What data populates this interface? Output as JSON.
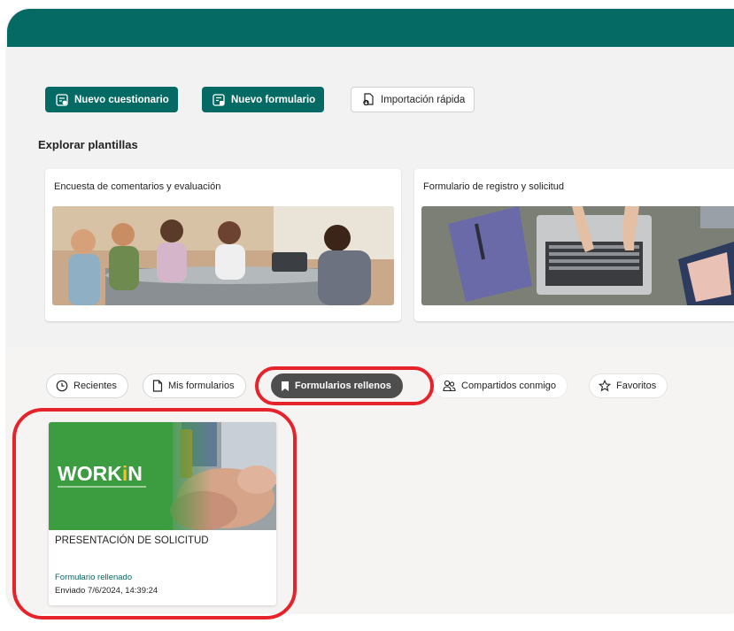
{
  "toolbar": {
    "new_quiz": "Nuevo cuestionario",
    "new_form": "Nuevo formulario",
    "quick_import": "Importación rápida"
  },
  "templates": {
    "heading": "Explorar plantillas",
    "items": [
      {
        "title": "Encuesta de comentarios y evaluación",
        "image": "classroom-photo"
      },
      {
        "title": "Formulario de registro y solicitud",
        "image": "laptop-photo"
      }
    ]
  },
  "filters": {
    "recent": "Recientes",
    "my_forms": "Mis formularios",
    "filled_forms": "Formularios rellenos",
    "shared_with_me": "Compartidos conmigo",
    "favorites": "Favoritos",
    "active": "filled_forms"
  },
  "form_card": {
    "thumbnail_logo": "WORKiN",
    "title": "PRESENTACIÓN DE SOLICITUD",
    "status": "Formulario rellenado",
    "date": "Enviado 7/6/2024, 14:39:24"
  },
  "colors": {
    "brand": "#046a63",
    "highlight": "#e6232b",
    "active_pill": "#4e4e4e",
    "logo_accent": "#f2c230"
  }
}
